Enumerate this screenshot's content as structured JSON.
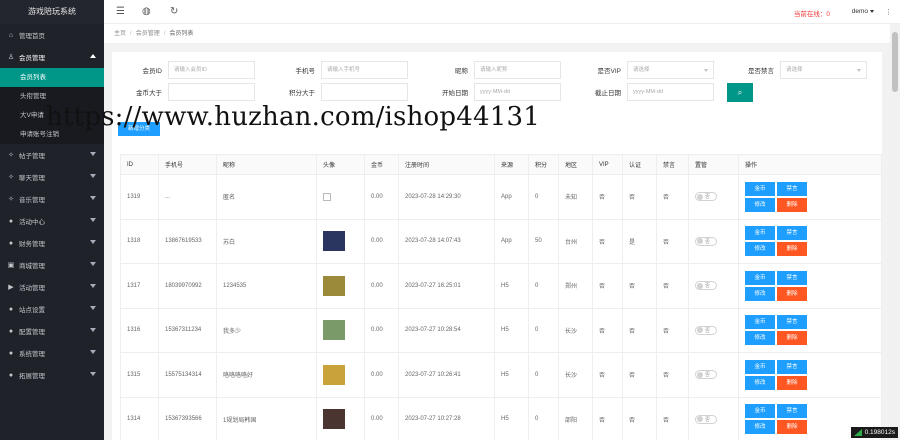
{
  "sidebar": {
    "logo": "游戏陪玩系统",
    "items": [
      {
        "icon": "⌂",
        "label": "管理首页",
        "expanded": false
      },
      {
        "icon": "♙",
        "label": "会员管理",
        "expanded": true
      },
      {
        "icon": "✧",
        "label": "帖子管理",
        "expanded": false
      },
      {
        "icon": "✧",
        "label": "聊天管理",
        "expanded": false
      },
      {
        "icon": "✧",
        "label": "音乐管理",
        "expanded": false
      },
      {
        "icon": "●",
        "label": "活动中心",
        "expanded": false
      },
      {
        "icon": "●",
        "label": "财务管理",
        "expanded": false
      },
      {
        "icon": "▣",
        "label": "商城管理",
        "expanded": false
      },
      {
        "icon": "▶",
        "label": "活动管理",
        "expanded": false
      },
      {
        "icon": "●",
        "label": "站点设置",
        "expanded": false
      },
      {
        "icon": "●",
        "label": "配置管理",
        "expanded": false
      },
      {
        "icon": "●",
        "label": "系统管理",
        "expanded": false
      },
      {
        "icon": "●",
        "label": "拓展管理",
        "expanded": false
      }
    ],
    "subitems": [
      "会员列表",
      "头衔管理",
      "大V申请",
      "申请账号注销"
    ]
  },
  "topbar": {
    "online": "当前在线：0",
    "user": "demo"
  },
  "breadcrumb": {
    "home": "主页",
    "section": "会员管理",
    "current": "会员列表"
  },
  "filters": {
    "member_id": {
      "label": "会员ID",
      "placeholder": "请输入会员ID"
    },
    "phone": {
      "label": "手机号",
      "placeholder": "请输入手机号"
    },
    "nickname": {
      "label": "昵称",
      "placeholder": "请输入昵称"
    },
    "vip": {
      "label": "是否VIP",
      "placeholder": "请选择"
    },
    "banned": {
      "label": "是否禁言",
      "placeholder": "请选择"
    },
    "coins_gt": {
      "label": "金币大于",
      "placeholder": ""
    },
    "points_gt": {
      "label": "积分大于",
      "placeholder": ""
    },
    "start_date": {
      "label": "开始日期",
      "placeholder": "yyyy-MM-dd"
    },
    "end_date": {
      "label": "截止日期",
      "placeholder": "yyyy-MM-dd"
    },
    "search_icon": "search-icon"
  },
  "batch_button": "新增分类",
  "watermark": "https://www.huzhan.com/ishop44131",
  "table": {
    "headers": [
      "ID",
      "手机号",
      "昵称",
      "头像",
      "金币",
      "注册时间",
      "来源",
      "积分",
      "地区",
      "VIP",
      "认证",
      "禁言",
      "置管",
      "操作"
    ],
    "rows": [
      {
        "id": "1319",
        "phone": "...",
        "nickname": "匿名",
        "avatar": "broken",
        "coins": "0.00",
        "time": "2023-07-28 14:29:30",
        "source": "App",
        "points": "0",
        "region": "未知",
        "vip": "否",
        "verified": "否",
        "banned": "否",
        "toggle": "否"
      },
      {
        "id": "1318",
        "phone": "13867619533",
        "nickname": "苏白",
        "avatar": "#2a3560",
        "coins": "0.00",
        "time": "2023-07-28 14:07:43",
        "source": "App",
        "points": "50",
        "region": "台州",
        "vip": "否",
        "verified": "是",
        "banned": "否",
        "toggle": "否"
      },
      {
        "id": "1317",
        "phone": "18039970992",
        "nickname": "1234535",
        "avatar": "#9a8a3a",
        "coins": "0.00",
        "time": "2023-07-27 16:25:01",
        "source": "H5",
        "points": "0",
        "region": "郑州",
        "vip": "否",
        "verified": "否",
        "banned": "否",
        "toggle": "否"
      },
      {
        "id": "1316",
        "phone": "15367311234",
        "nickname": "我多少",
        "avatar": "#7a9a6a",
        "coins": "0.00",
        "time": "2023-07-27 10:28:54",
        "source": "H5",
        "points": "0",
        "region": "长沙",
        "vip": "否",
        "verified": "否",
        "banned": "否",
        "toggle": "否"
      },
      {
        "id": "1315",
        "phone": "15575134314",
        "nickname": "咯咯咯咯好",
        "avatar": "#c9a23a",
        "coins": "0.00",
        "time": "2023-07-27 10:26:41",
        "source": "H5",
        "points": "0",
        "region": "长沙",
        "vip": "否",
        "verified": "否",
        "banned": "否",
        "toggle": "否"
      },
      {
        "id": "1314",
        "phone": "15367393566",
        "nickname": "1规划局韩国",
        "avatar": "#4a3530",
        "coins": "0.00",
        "time": "2023-07-27 10:27:28",
        "source": "H5",
        "points": "0",
        "region": "邵阳",
        "vip": "否",
        "verified": "否",
        "banned": "否",
        "toggle": "否"
      }
    ],
    "ops": {
      "coins": "金币",
      "ban": "禁言",
      "edit": "修改",
      "delete": "删除"
    }
  },
  "timer": "0.198012s",
  "colors": {
    "sidebar": "#20222a",
    "active": "#009688",
    "primary": "#1e9fff",
    "danger": "#ff5722"
  }
}
